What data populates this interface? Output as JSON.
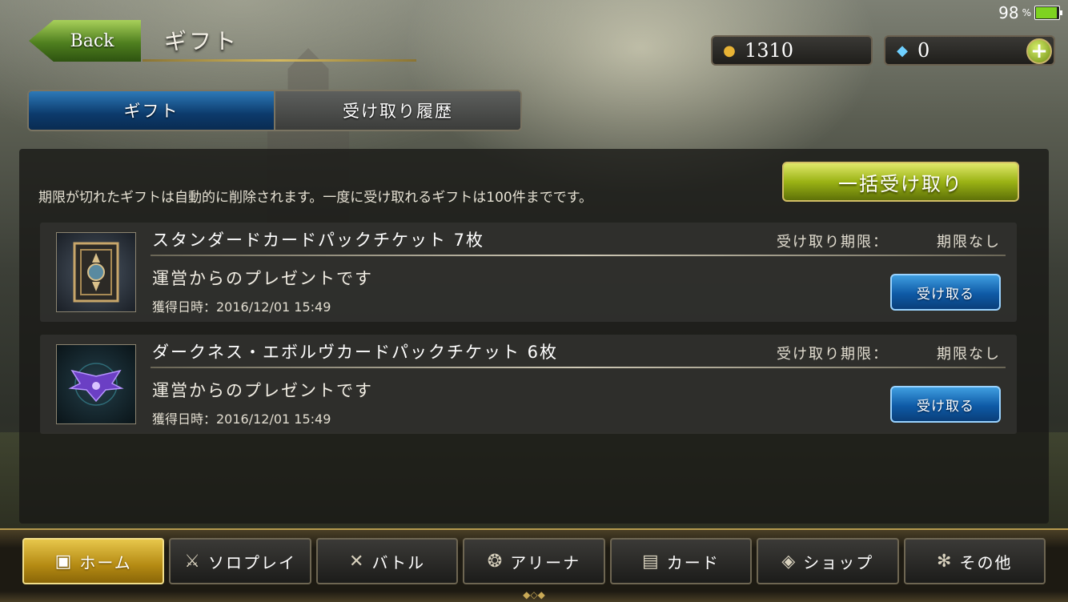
{
  "status_bar": {
    "battery_percent": "98",
    "percent_sign": "%",
    "battery_level": 0.98
  },
  "header": {
    "back_label": "Back",
    "title": "ギフト"
  },
  "currency": {
    "coins": "1310",
    "crystals": "0",
    "coin_icon": "coin-bag-icon",
    "crystal_icon": "crystal-icon",
    "add_icon": "plus-icon"
  },
  "tabs": [
    {
      "label": "ギフト",
      "active": true
    },
    {
      "label": "受け取り履歴",
      "active": false
    }
  ],
  "notice": "期限が切れたギフトは自動的に削除されます。一度に受け取れるギフトは100件までです。",
  "bulk_receive_label": "一括受け取り",
  "gifts": [
    {
      "name": "スタンダードカードパックチケット 7枚",
      "deadline_label": "受け取り期限：",
      "deadline_value": "期限なし",
      "description": "運営からのプレゼントです",
      "date": "獲得日時：2016/12/01 15:49",
      "button_label": "受け取る",
      "icon": "standard-card-pack-icon"
    },
    {
      "name": "ダークネス・エボルヴカードパックチケット 6枚",
      "deadline_label": "受け取り期限：",
      "deadline_value": "期限なし",
      "description": "運営からのプレゼントです",
      "date": "獲得日時：2016/12/01 15:49",
      "button_label": "受け取る",
      "icon": "darkness-evolve-card-pack-icon"
    }
  ],
  "nav": [
    {
      "label": "ホーム",
      "icon": "home-icon",
      "active": true
    },
    {
      "label": "ソロプレイ",
      "icon": "sword-shield-icon",
      "active": false
    },
    {
      "label": "バトル",
      "icon": "crossed-swords-icon",
      "active": false
    },
    {
      "label": "アリーナ",
      "icon": "arena-icon",
      "active": false
    },
    {
      "label": "カード",
      "icon": "cards-icon",
      "active": false
    },
    {
      "label": "ショップ",
      "icon": "crystal-shop-icon",
      "active": false
    },
    {
      "label": "その他",
      "icon": "other-icon",
      "active": false
    }
  ],
  "colors": {
    "accent_blue": "#0e5aa6",
    "accent_green": "#9bb315",
    "accent_gold": "#b48a13"
  }
}
